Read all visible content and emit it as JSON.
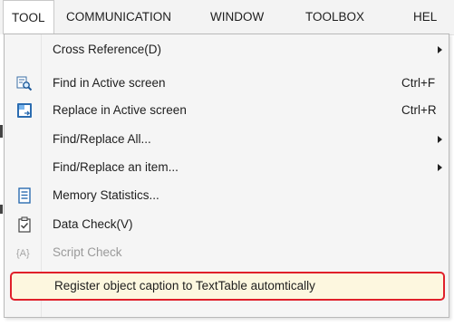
{
  "menubar": {
    "items": [
      {
        "label": "TOOL",
        "active": true
      },
      {
        "label": "COMMUNICATION"
      },
      {
        "label": "WINDOW"
      },
      {
        "label": "TOOLBOX"
      },
      {
        "label": "HEL"
      }
    ]
  },
  "menu": {
    "items": [
      {
        "label": "Cross Reference(D)",
        "submenu": true
      },
      {
        "label": "Find in Active screen",
        "shortcut": "Ctrl+F",
        "icon": "find-icon"
      },
      {
        "label": "Replace in Active screen",
        "shortcut": "Ctrl+R",
        "icon": "replace-icon"
      },
      {
        "label": "Find/Replace All...",
        "submenu": true
      },
      {
        "label": "Find/Replace an item...",
        "submenu": true
      },
      {
        "label": "Memory Statistics...",
        "icon": "memory-statistics-icon"
      },
      {
        "label": "Data Check(V)",
        "icon": "data-check-icon"
      },
      {
        "label": "Script Check",
        "icon": "script-check-icon",
        "disabled": true
      },
      {
        "label": "Register object caption to TextTable automtically",
        "highlighted": true
      }
    ]
  },
  "colors": {
    "highlight_border": "#e0202a",
    "highlight_fill": "#fdf7df",
    "menu_bg": "#f5f5f5"
  }
}
